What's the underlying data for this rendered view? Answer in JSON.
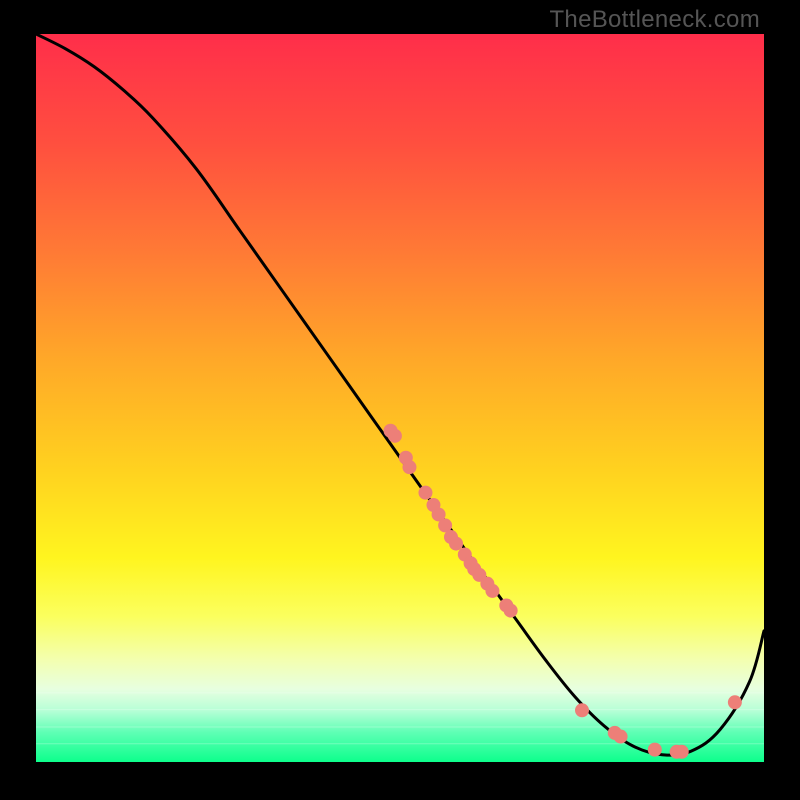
{
  "watermark": "TheBottleneck.com",
  "chart_data": {
    "type": "line",
    "title": "",
    "xlabel": "",
    "ylabel": "",
    "xlim": [
      0,
      100
    ],
    "ylim": [
      0,
      100
    ],
    "legend": false,
    "grid": false,
    "gradient_stops": [
      {
        "offset": 0.0,
        "color": "#ff2e4a"
      },
      {
        "offset": 0.15,
        "color": "#ff4f3f"
      },
      {
        "offset": 0.3,
        "color": "#ff7a35"
      },
      {
        "offset": 0.45,
        "color": "#ffa928"
      },
      {
        "offset": 0.6,
        "color": "#ffd21f"
      },
      {
        "offset": 0.72,
        "color": "#fff51f"
      },
      {
        "offset": 0.8,
        "color": "#fbff5e"
      },
      {
        "offset": 0.86,
        "color": "#f3ffb0"
      },
      {
        "offset": 0.9,
        "color": "#e7ffe0"
      },
      {
        "offset": 0.93,
        "color": "#b5ffd6"
      },
      {
        "offset": 0.96,
        "color": "#5dffb4"
      },
      {
        "offset": 1.0,
        "color": "#0dff8c"
      }
    ],
    "series": [
      {
        "name": "bottleneck-curve",
        "color": "#000000",
        "x": [
          0,
          4,
          8,
          12,
          16,
          22,
          28,
          34,
          40,
          46,
          52,
          58,
          62,
          66,
          70,
          74,
          78,
          82,
          86,
          90,
          94,
          98,
          100
        ],
        "y": [
          100,
          98,
          95.5,
          92.3,
          88.5,
          81.5,
          73,
          64.5,
          56,
          47.5,
          39,
          30.5,
          25,
          19.5,
          14,
          9,
          5,
          2.2,
          1,
          1.5,
          4.5,
          11,
          18
        ]
      }
    ],
    "scatter": [
      {
        "name": "highlight-points",
        "color": "#ed7f78",
        "radius": 7,
        "points": [
          {
            "x": 48.7,
            "y": 45.5
          },
          {
            "x": 49.3,
            "y": 44.8
          },
          {
            "x": 50.8,
            "y": 41.8
          },
          {
            "x": 51.3,
            "y": 40.5
          },
          {
            "x": 53.5,
            "y": 37.0
          },
          {
            "x": 54.6,
            "y": 35.3
          },
          {
            "x": 55.3,
            "y": 34.0
          },
          {
            "x": 56.2,
            "y": 32.5
          },
          {
            "x": 57.0,
            "y": 30.9
          },
          {
            "x": 57.7,
            "y": 30.0
          },
          {
            "x": 58.9,
            "y": 28.5
          },
          {
            "x": 59.7,
            "y": 27.3
          },
          {
            "x": 60.2,
            "y": 26.5
          },
          {
            "x": 60.9,
            "y": 25.7
          },
          {
            "x": 62.0,
            "y": 24.5
          },
          {
            "x": 62.7,
            "y": 23.5
          },
          {
            "x": 64.6,
            "y": 21.5
          },
          {
            "x": 65.2,
            "y": 20.8
          },
          {
            "x": 75.0,
            "y": 7.1
          },
          {
            "x": 79.5,
            "y": 4.0
          },
          {
            "x": 80.3,
            "y": 3.5
          },
          {
            "x": 85.0,
            "y": 1.7
          },
          {
            "x": 88.0,
            "y": 1.4
          },
          {
            "x": 88.7,
            "y": 1.4
          },
          {
            "x": 96.0,
            "y": 8.2
          }
        ]
      }
    ]
  }
}
